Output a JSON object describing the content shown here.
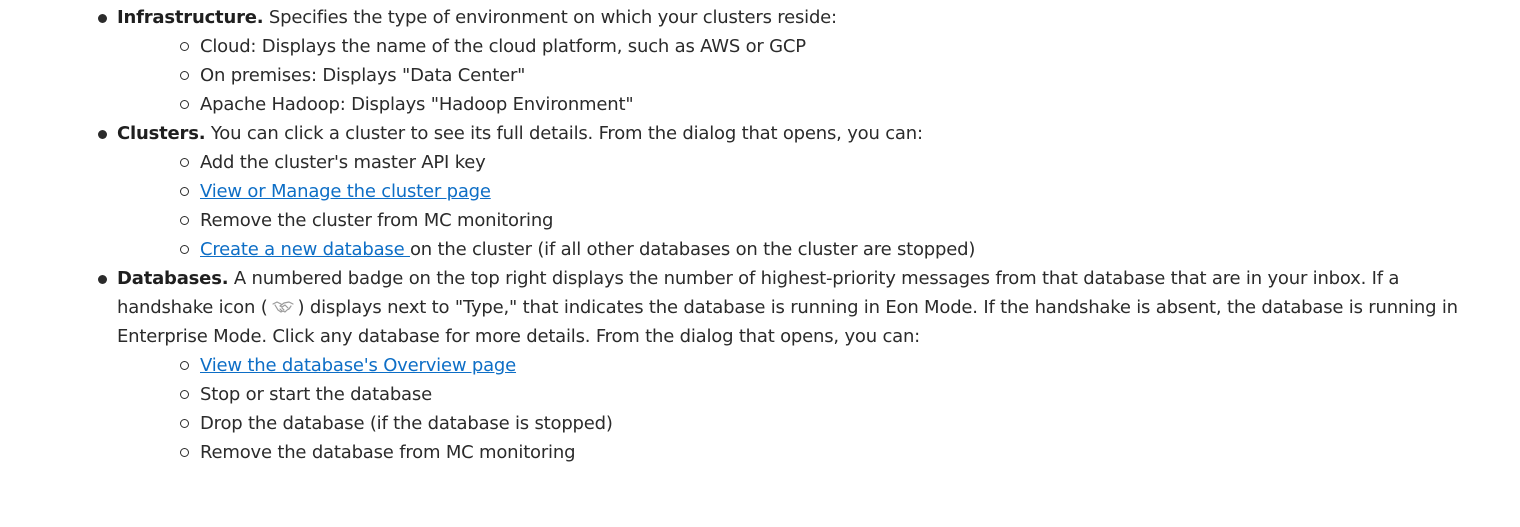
{
  "items": [
    {
      "term": "Infrastructure.",
      "text": " Specifies the type of environment on which your clusters reside:",
      "sub": [
        "Cloud: Displays the name of the cloud platform, such as AWS or GCP",
        "On premises: Displays \"Data Center\"",
        "Apache Hadoop: Displays \"Hadoop Environment\""
      ]
    },
    {
      "term": "Clusters.",
      "text": " You can click a cluster to see its full details. From the dialog that opens, you can:",
      "sub0": "Add the cluster's master API key",
      "sub1_link": "View or Manage the cluster page",
      "sub2": "Remove the cluster from MC monitoring",
      "sub3_link": "Create a new database ",
      "sub3_text": "on the cluster (if all other databases on the cluster are stopped)"
    },
    {
      "term": "Databases.",
      "text_before_icon": " A numbered badge on the top right displays the number of highest-priority messages from that database that are in your inbox. If a handshake icon (",
      "text_after_icon": ") displays next to \"Type,\" that indicates the database is running in Eon Mode. If the handshake is absent, the database is running in Enterprise Mode. Click any database for more details. From the dialog that opens, you can:",
      "sub0_link": "View the database's Overview page",
      "sub1": "Stop or start the database",
      "sub2": "Drop the database (if the database is stopped)",
      "sub3": "Remove the database from MC monitoring"
    }
  ],
  "icons": {
    "handshake": "handshake-icon"
  },
  "colors": {
    "text": "#2b2b2b",
    "link": "#0d6ec6"
  }
}
